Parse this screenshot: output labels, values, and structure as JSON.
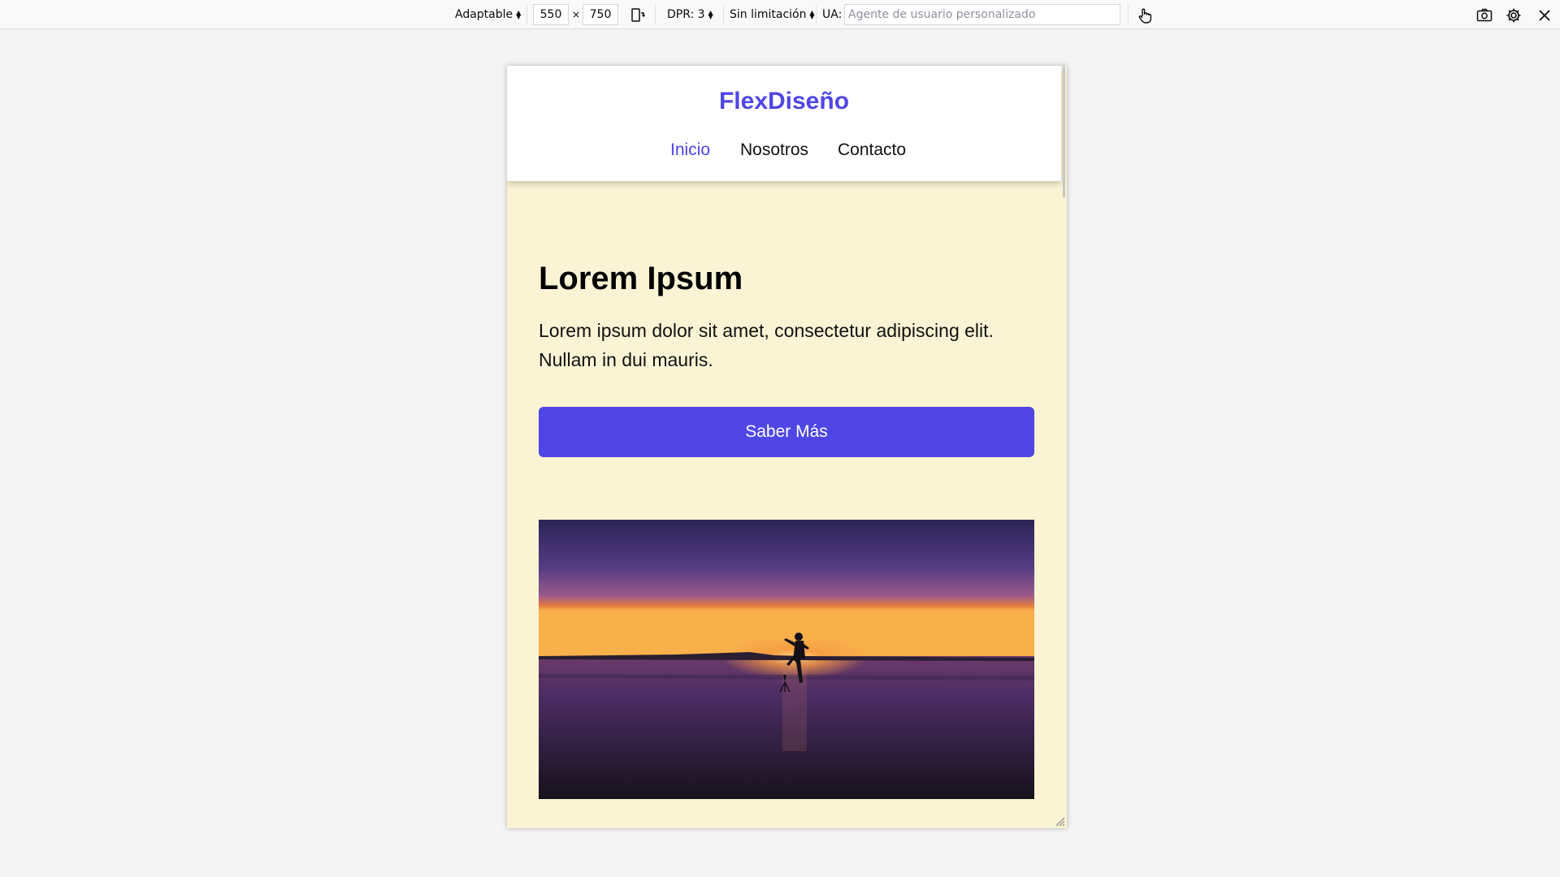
{
  "toolbar": {
    "device_mode": "Adaptable",
    "width": "550",
    "separator": "×",
    "height": "750",
    "dpr": "DPR: 3",
    "throttling": "Sin limitación",
    "ua_label": "UA:",
    "ua_placeholder": "Agente de usuario personalizado",
    "icons": [
      "rotate-icon",
      "touch-icon",
      "screenshot-icon",
      "settings-icon",
      "close-icon"
    ]
  },
  "site": {
    "brand": "FlexDiseño",
    "nav": [
      {
        "label": "Inicio",
        "active": true
      },
      {
        "label": "Nosotros",
        "active": false
      },
      {
        "label": "Contacto",
        "active": false
      }
    ],
    "hero": {
      "title": "Lorem Ipsum",
      "text": "Lorem ipsum dolor sit amet, consectetur adipiscing elit. Nullam in dui mauris.",
      "button": "Saber Más"
    }
  },
  "colors": {
    "accent": "#4f46e5",
    "page_background": "#faf4d5",
    "header_background": "#ffffff",
    "toolbar_background": "#f9f9fa"
  }
}
